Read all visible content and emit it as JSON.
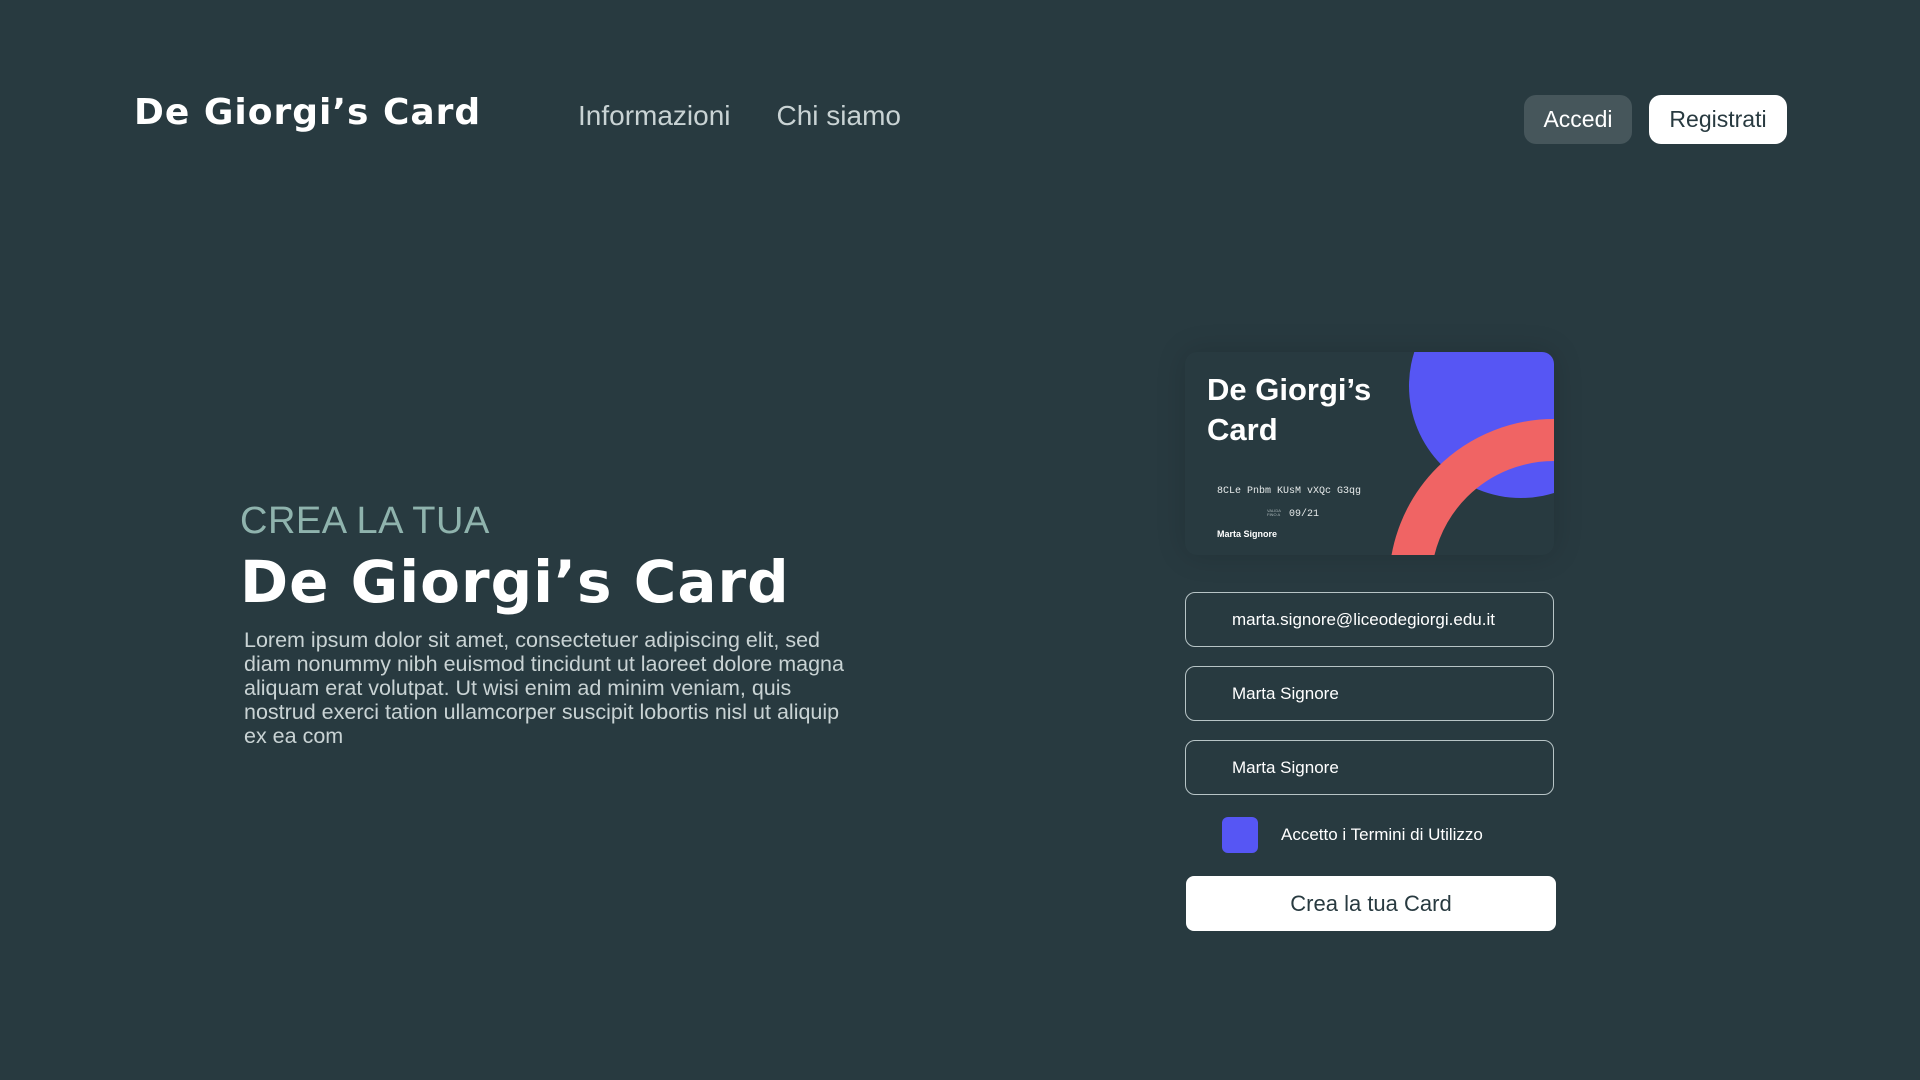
{
  "header": {
    "logo": "De Giorgi’s Card",
    "nav": [
      {
        "label": "Informazioni"
      },
      {
        "label": "Chi siamo"
      }
    ],
    "login_label": "Accedi",
    "register_label": "Registrati"
  },
  "hero": {
    "kicker": "CREA LA TUA",
    "title": "De Giorgi’s Card",
    "text": "Lorem ipsum dolor sit amet, consectetuer adipiscing elit, sed diam nonummy nibh euismod tincidunt ut laoreet dolore magna aliquam erat volutpat. Ut wisi enim ad minim veniam, quis nostrud exerci tation ullamcorper suscipit lobortis nisl ut aliquip ex ea com"
  },
  "card": {
    "title": "De Giorgi’s Card",
    "number": "8CLe Pnbm KUsM vXQc G3qg",
    "valid_label": "VALIDA FINO A",
    "expiry": "09/21",
    "holder": "Marta Signore"
  },
  "form": {
    "email_value": "marta.signore@liceodegiorgi.edu.it",
    "name_value": "Marta Signore",
    "surname_value": "Marta Signore",
    "terms_label": "Accetto i Termini di Utilizzo",
    "terms_checked": true,
    "submit_label": "Crea la tua Card"
  },
  "colors": {
    "background": "#283a40",
    "accent_blue": "#5656f4",
    "accent_red": "#f06464",
    "kicker": "#8fb3ad"
  }
}
